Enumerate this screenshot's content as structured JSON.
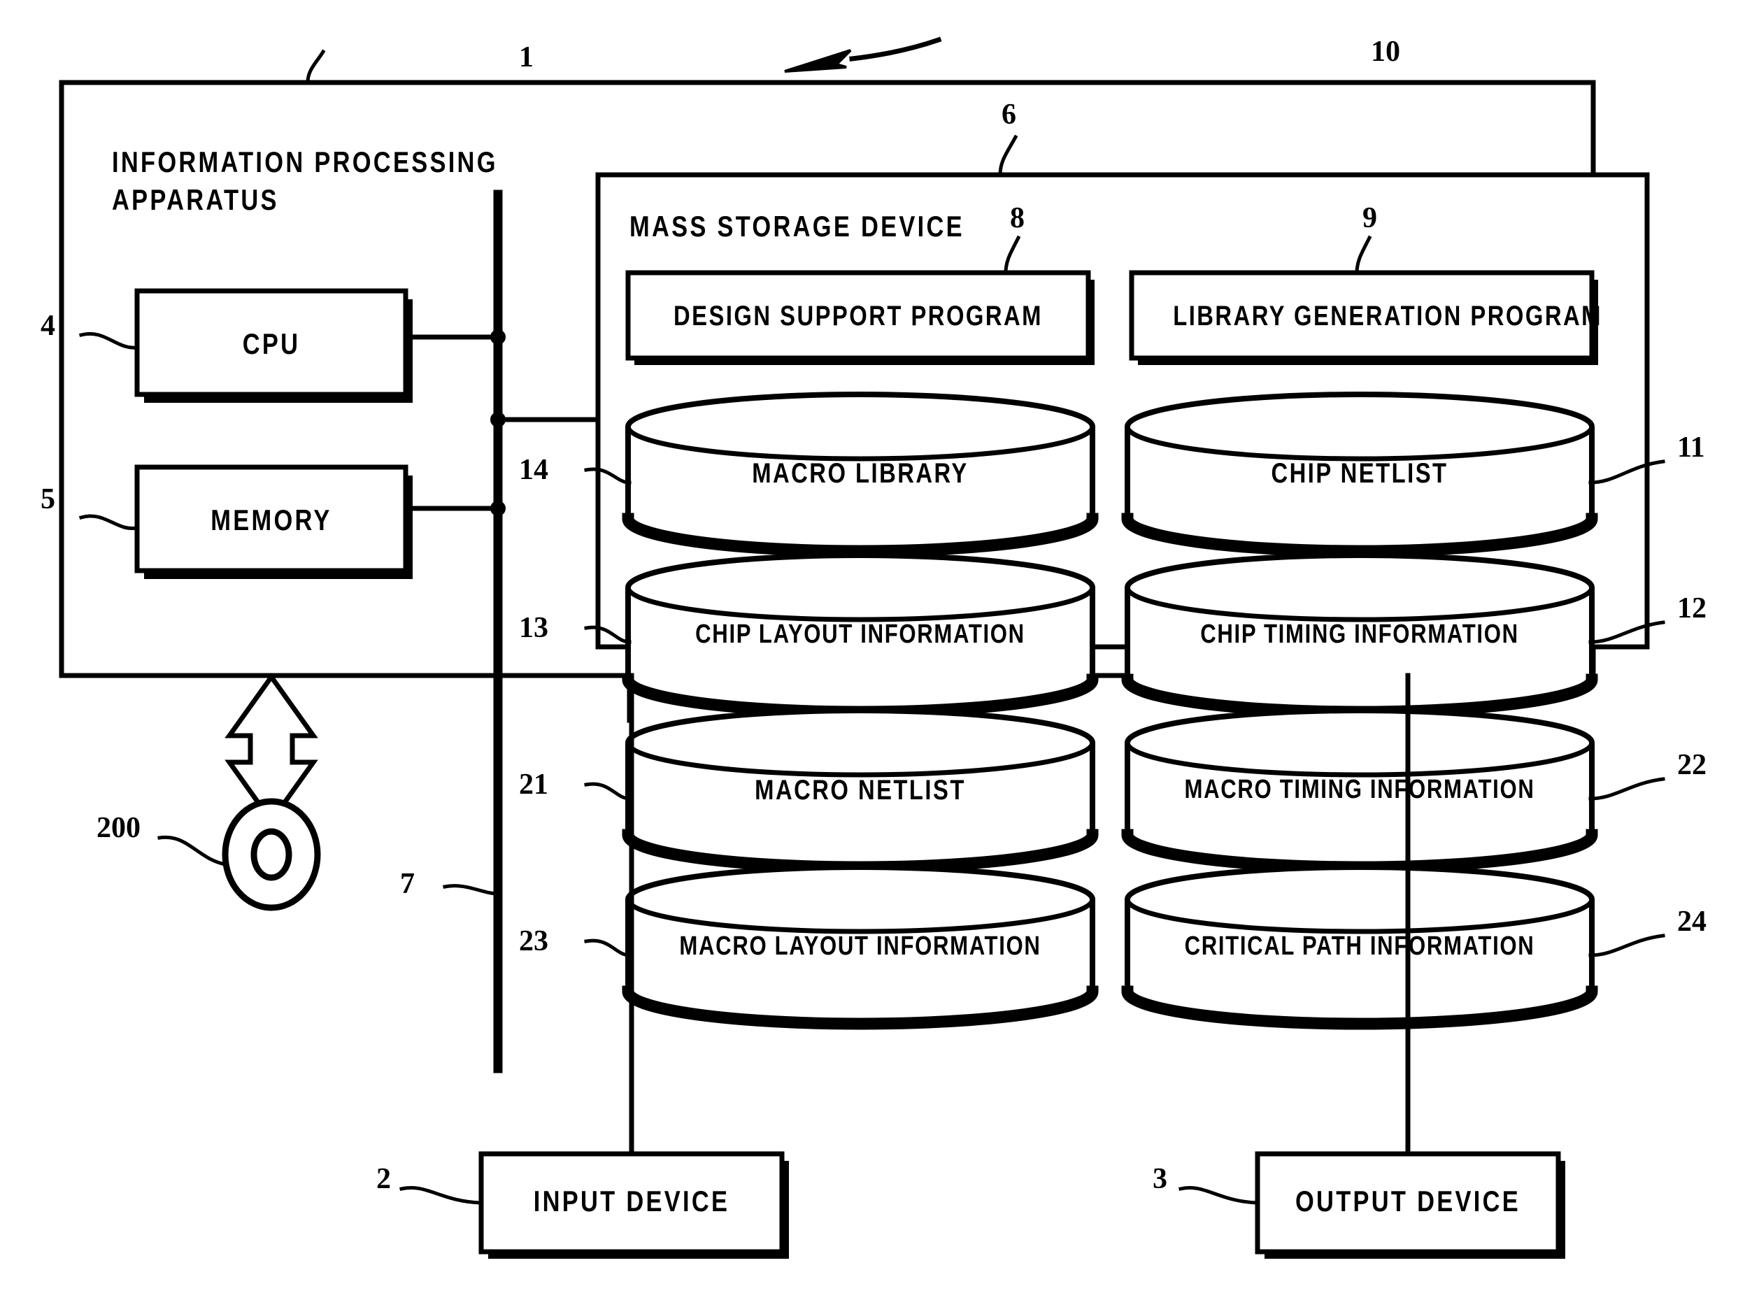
{
  "figure": {
    "title_block": {
      "label": "INFORMATION PROCESSING APPARATUS",
      "line1": "INFORMATION PROCESSING",
      "line2": "APPARATUS",
      "ref": "1"
    },
    "overall_ref": "10",
    "bus": {
      "ref": "7"
    },
    "external_media": {
      "ref": "200",
      "icon": "optical-disc-icon"
    },
    "components": [
      {
        "ref": "4",
        "label": "CPU",
        "type": "box"
      },
      {
        "ref": "5",
        "label": "MEMORY",
        "type": "box"
      },
      {
        "ref": "2",
        "label": "INPUT DEVICE",
        "type": "box"
      },
      {
        "ref": "3",
        "label": "OUTPUT DEVICE",
        "type": "box"
      }
    ],
    "mass_storage": {
      "ref": "6",
      "label": "MASS STORAGE DEVICE",
      "programs": [
        {
          "ref": "8",
          "label": "DESIGN SUPPORT PROGRAM"
        },
        {
          "ref": "9",
          "label": "LIBRARY GENERATION PROGRAM"
        }
      ],
      "databases_left": [
        {
          "ref": "14",
          "label": "MACRO LIBRARY"
        },
        {
          "ref": "13",
          "label": "CHIP LAYOUT INFORMATION"
        },
        {
          "ref": "21",
          "label": "MACRO NETLIST"
        },
        {
          "ref": "23",
          "label": "MACRO LAYOUT INFORMATION"
        }
      ],
      "databases_right": [
        {
          "ref": "11",
          "label": "CHIP NETLIST"
        },
        {
          "ref": "12",
          "label": "CHIP TIMING INFORMATION"
        },
        {
          "ref": "22",
          "label": "MACRO TIMING INFORMATION"
        },
        {
          "ref": "24",
          "label": "CRITICAL PATH INFORMATION"
        }
      ]
    },
    "colors": {
      "ink": "#000000",
      "paper": "#ffffff"
    }
  }
}
